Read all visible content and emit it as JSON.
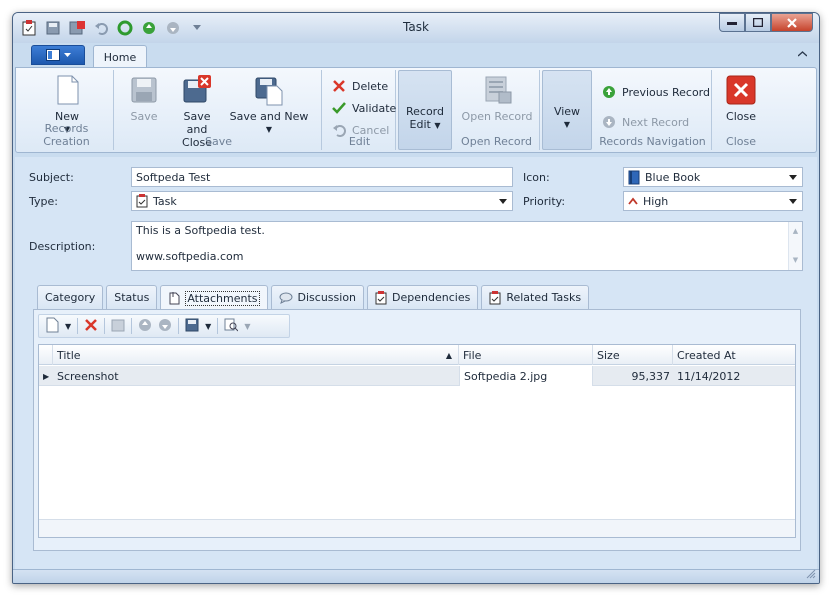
{
  "window": {
    "title": "Task"
  },
  "ribbon": {
    "tab_home": "Home",
    "groups": {
      "records_creation": {
        "label": "Records Creation",
        "new": "New"
      },
      "save": {
        "label": "Save",
        "save": "Save",
        "save_close_1": "Save and",
        "save_close_2": "Close",
        "save_new": "Save and New"
      },
      "edit": {
        "label": "Edit",
        "delete": "Delete",
        "validate": "Validate",
        "cancel": "Cancel"
      },
      "record_edit": {
        "label_1": "Record",
        "label_2": "Edit"
      },
      "open_record": {
        "label": "Open Record",
        "button": "Open Record"
      },
      "view": {
        "label": "View"
      },
      "navigation": {
        "label": "Records Navigation",
        "previous": "Previous Record",
        "next": "Next Record"
      },
      "close": {
        "label": "Close",
        "button": "Close"
      }
    }
  },
  "form": {
    "subject_label": "Subject:",
    "subject_value": "Softpeda Test",
    "icon_label": "Icon:",
    "icon_value": "Blue Book",
    "type_label": "Type:",
    "type_value": "Task",
    "priority_label": "Priority:",
    "priority_value": "High",
    "description_label": "Description:",
    "description_line1": "This is a Softpedia test.",
    "description_line2": "www.softpedia.com"
  },
  "tabs": [
    "Category",
    "Status",
    "Attachments",
    "Discussion",
    "Dependencies",
    "Related Tasks"
  ],
  "grid": {
    "columns": [
      "Title",
      "File",
      "Size",
      "Created At"
    ],
    "rows": [
      {
        "title": "Screenshot",
        "file": "Softpedia 2.jpg",
        "size": "95,337",
        "created": "11/14/2012"
      }
    ]
  },
  "colors": {
    "accent": "#1d58ae",
    "close_red": "#d9372a",
    "validate_green": "#3a9a2a",
    "window_bg": "#c9dcef"
  }
}
